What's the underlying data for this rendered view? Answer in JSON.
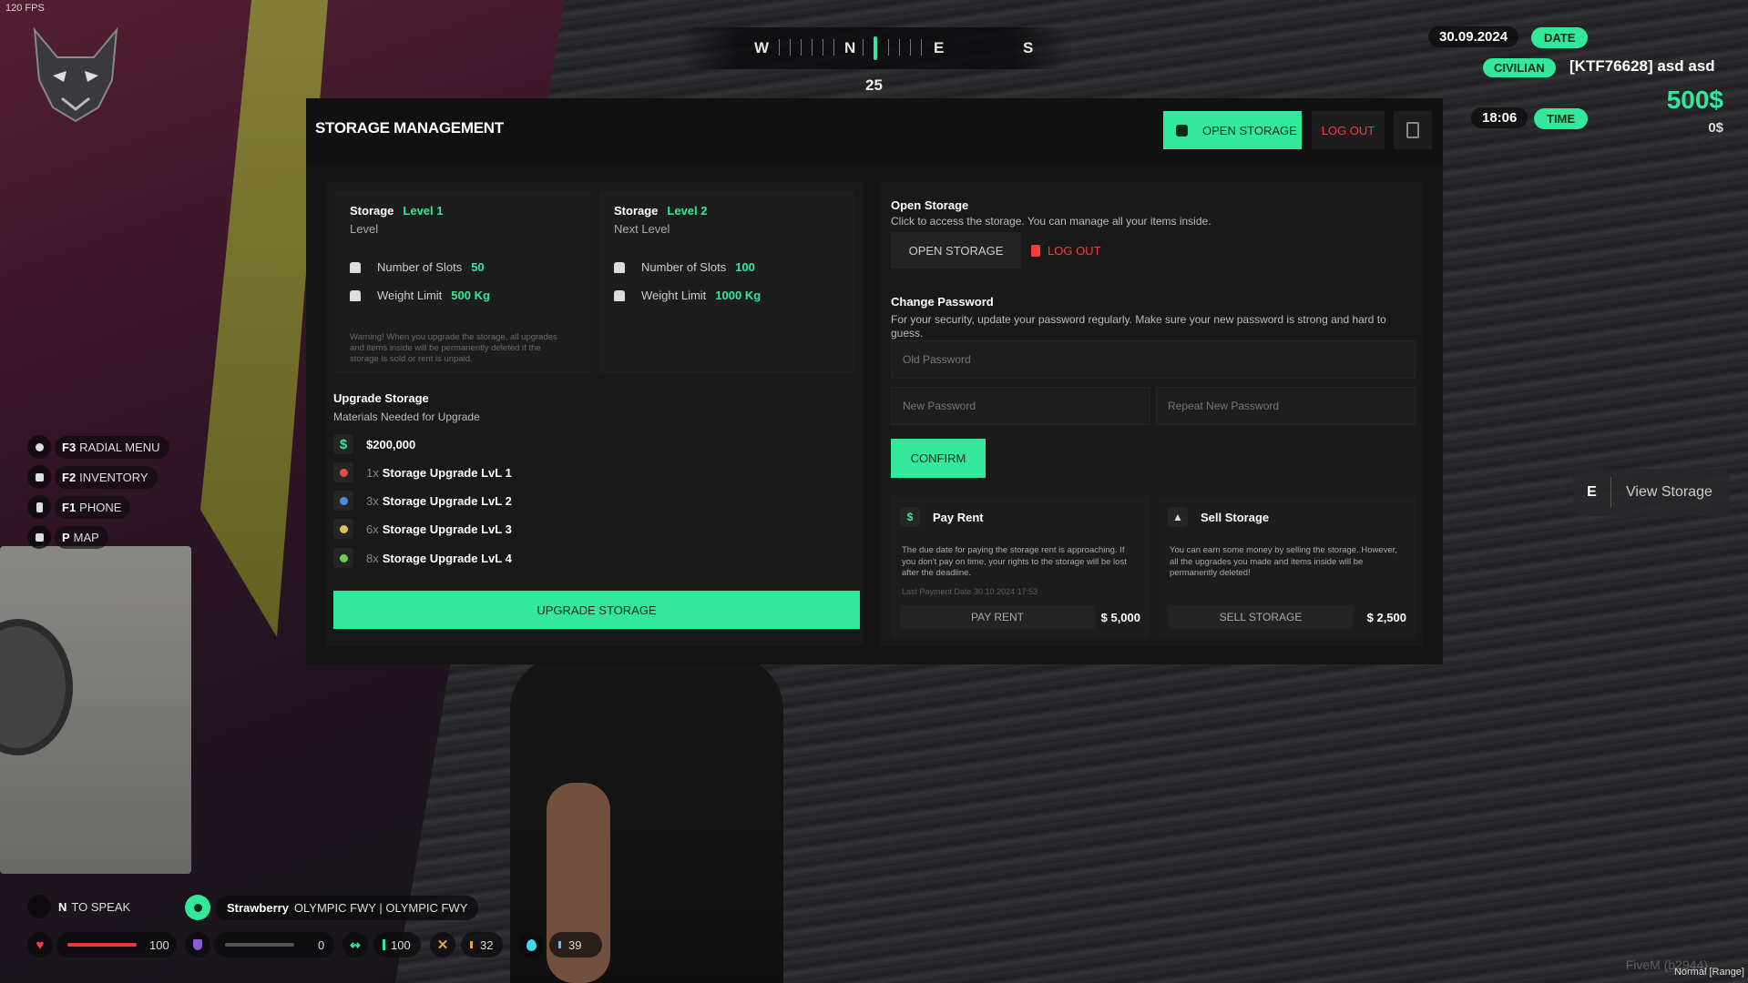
{
  "hud": {
    "fps": "120 FPS",
    "compass": {
      "w": "W",
      "n": "N",
      "e": "E",
      "s": "S",
      "heading": "25"
    },
    "date": "30.09.2024",
    "date_label": "DATE",
    "job": "CIVILIAN",
    "player": "[KTF76628] asd asd",
    "time": "18:06",
    "time_label": "TIME",
    "cash": "500$",
    "bank": "0$",
    "menu": [
      {
        "key": "F3",
        "label": "RADIAL MENU",
        "icon": "radial-icon"
      },
      {
        "key": "F2",
        "label": "INVENTORY",
        "icon": "inventory-icon"
      },
      {
        "key": "F1",
        "label": "PHONE",
        "icon": "phone-icon"
      },
      {
        "key": "P",
        "label": "MAP",
        "icon": "map-icon"
      }
    ],
    "prompt": {
      "key": "E",
      "label": "View Storage"
    },
    "speak": {
      "key": "N",
      "label": "TO SPEAK"
    },
    "location": {
      "street": "Strawberry",
      "road": "OLYMPIC FWY | OLYMPIC FWY"
    },
    "status": {
      "health": "100",
      "armor": "0",
      "stamina": "100",
      "hunger": "32",
      "thirst": "39"
    },
    "health_fraction": 1.0,
    "armor_fraction": 0.0,
    "watermark": "FiveM (b2944)",
    "range": "Normal [Range]"
  },
  "panel": {
    "title": "STORAGE MANAGEMENT",
    "open_storage": "OPEN STORAGE",
    "log_out": "LOG OUT",
    "current": {
      "label": "Storage",
      "level": "Level 1",
      "sub": "Level",
      "slots_label": "Number of Slots",
      "slots": "50",
      "weight_label": "Weight Limit",
      "weight": "500 Kg"
    },
    "next": {
      "label": "Storage",
      "level": "Level 2",
      "sub": "Next Level",
      "slots_label": "Number of Slots",
      "slots": "100",
      "weight_label": "Weight Limit",
      "weight": "1000 Kg"
    },
    "warning": "Warning! When you upgrade the storage, all upgrades and items inside will be permanently deleted if the storage is sold or rent is unpaid.",
    "upgrade": {
      "title": "Upgrade Storage",
      "sub": "Materials Needed for Upgrade",
      "money": "$200,000",
      "items": [
        {
          "count": "1x",
          "name": "Storage Upgrade LvL 1",
          "color": "#e0504a"
        },
        {
          "count": "3x",
          "name": "Storage Upgrade LvL 2",
          "color": "#4a8ae0"
        },
        {
          "count": "6x",
          "name": "Storage Upgrade LvL 3",
          "color": "#e0c44a"
        },
        {
          "count": "8x",
          "name": "Storage Upgrade LvL 4",
          "color": "#6ad04a"
        }
      ],
      "button": "UPGRADE STORAGE"
    },
    "open_section": {
      "title": "Open Storage",
      "desc": "Click to access the storage. You can manage all your items inside.",
      "open": "OPEN STORAGE",
      "logout": "LOG OUT"
    },
    "password": {
      "title": "Change Password",
      "desc": "For your security, update your password regularly. Make sure your new password is strong and hard to guess.",
      "old_ph": "Old Password",
      "new_ph": "New Password",
      "repeat_ph": "Repeat New Password",
      "confirm": "CONFIRM"
    },
    "rent": {
      "title": "Pay Rent",
      "desc": "The due date for paying the storage rent is approaching. If you don't pay on time, your rights to the storage will be lost after the deadline.",
      "last": "Last Payment Date 30.10.2024 17:53",
      "button": "PAY RENT",
      "price": "$ 5,000"
    },
    "sell": {
      "title": "Sell Storage",
      "desc": "You can earn some money by selling the storage. However, all the upgrades you made and items inside will be permanently deleted!",
      "button": "SELL STORAGE",
      "price": "$ 2,500"
    }
  },
  "colors": {
    "accent": "#33e89a",
    "danger": "#ff3a3a",
    "panel": "#141414"
  }
}
